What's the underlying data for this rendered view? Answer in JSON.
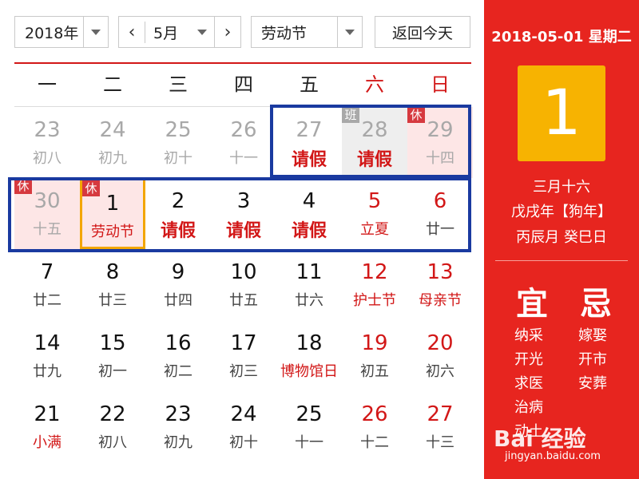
{
  "controls": {
    "year": "2018年",
    "month": "5月",
    "holiday": "劳动节",
    "today_btn": "返回今天"
  },
  "weekdays": [
    "一",
    "二",
    "三",
    "四",
    "五",
    "六",
    "日"
  ],
  "colors": {
    "accent_red": "#d21717",
    "sidebar_red": "#e7251f",
    "today_gold": "#f7b301",
    "highlight_blue": "#1a3aa0"
  },
  "rows": [
    [
      {
        "n": "23",
        "s": "初八",
        "t": "other"
      },
      {
        "n": "24",
        "s": "初九",
        "t": "other"
      },
      {
        "n": "25",
        "s": "初十",
        "t": "other"
      },
      {
        "n": "26",
        "s": "十一",
        "t": "other"
      },
      {
        "n": "27",
        "s": "请假",
        "t": "other big"
      },
      {
        "n": "28",
        "s": "请假",
        "t": "other big work",
        "tag": "班"
      },
      {
        "n": "29",
        "s": "十四",
        "t": "other rest",
        "tag": "休"
      }
    ],
    [
      {
        "n": "30",
        "s": "十五",
        "t": "other rest",
        "tag": "休"
      },
      {
        "n": "1",
        "s": "劳动节",
        "t": "rest today redsub",
        "tag": "休"
      },
      {
        "n": "2",
        "s": "请假",
        "t": "big"
      },
      {
        "n": "3",
        "s": "请假",
        "t": "big"
      },
      {
        "n": "4",
        "s": "请假",
        "t": "big"
      },
      {
        "n": "5",
        "s": "立夏",
        "t": "rednum redsub"
      },
      {
        "n": "6",
        "s": "廿一",
        "t": "rednum"
      }
    ],
    [
      {
        "n": "7",
        "s": "廿二"
      },
      {
        "n": "8",
        "s": "廿三"
      },
      {
        "n": "9",
        "s": "廿四"
      },
      {
        "n": "10",
        "s": "廿五"
      },
      {
        "n": "11",
        "s": "廿六"
      },
      {
        "n": "12",
        "s": "护士节",
        "t": "rednum redsub"
      },
      {
        "n": "13",
        "s": "母亲节",
        "t": "rednum redsub"
      }
    ],
    [
      {
        "n": "14",
        "s": "廿九"
      },
      {
        "n": "15",
        "s": "初一"
      },
      {
        "n": "16",
        "s": "初二"
      },
      {
        "n": "17",
        "s": "初三"
      },
      {
        "n": "18",
        "s": "博物馆日",
        "t": "redsub"
      },
      {
        "n": "19",
        "s": "初五",
        "t": "rednum"
      },
      {
        "n": "20",
        "s": "初六",
        "t": "rednum"
      }
    ],
    [
      {
        "n": "21",
        "s": "小满",
        "t": "redsub"
      },
      {
        "n": "22",
        "s": "初八"
      },
      {
        "n": "23",
        "s": "初九"
      },
      {
        "n": "24",
        "s": "初十"
      },
      {
        "n": "25",
        "s": "十一"
      },
      {
        "n": "26",
        "s": "十二",
        "t": "rednum"
      },
      {
        "n": "27",
        "s": "十三",
        "t": "rednum"
      }
    ]
  ],
  "sidebar": {
    "date": "2018-05-01 星期二",
    "day": "1",
    "lunar": "三月十六",
    "year_line": "戊戌年【狗年】",
    "month_line": "丙辰月 癸巳日",
    "yi": "宜",
    "ji": "忌",
    "yi_items": [
      "纳采",
      "开光",
      "求医",
      "治病",
      "动土"
    ],
    "ji_items": [
      "嫁娶",
      "开市",
      "安葬"
    ]
  },
  "watermark": {
    "brand": "Bai 经验",
    "url": "jingyan.baidu.com"
  }
}
